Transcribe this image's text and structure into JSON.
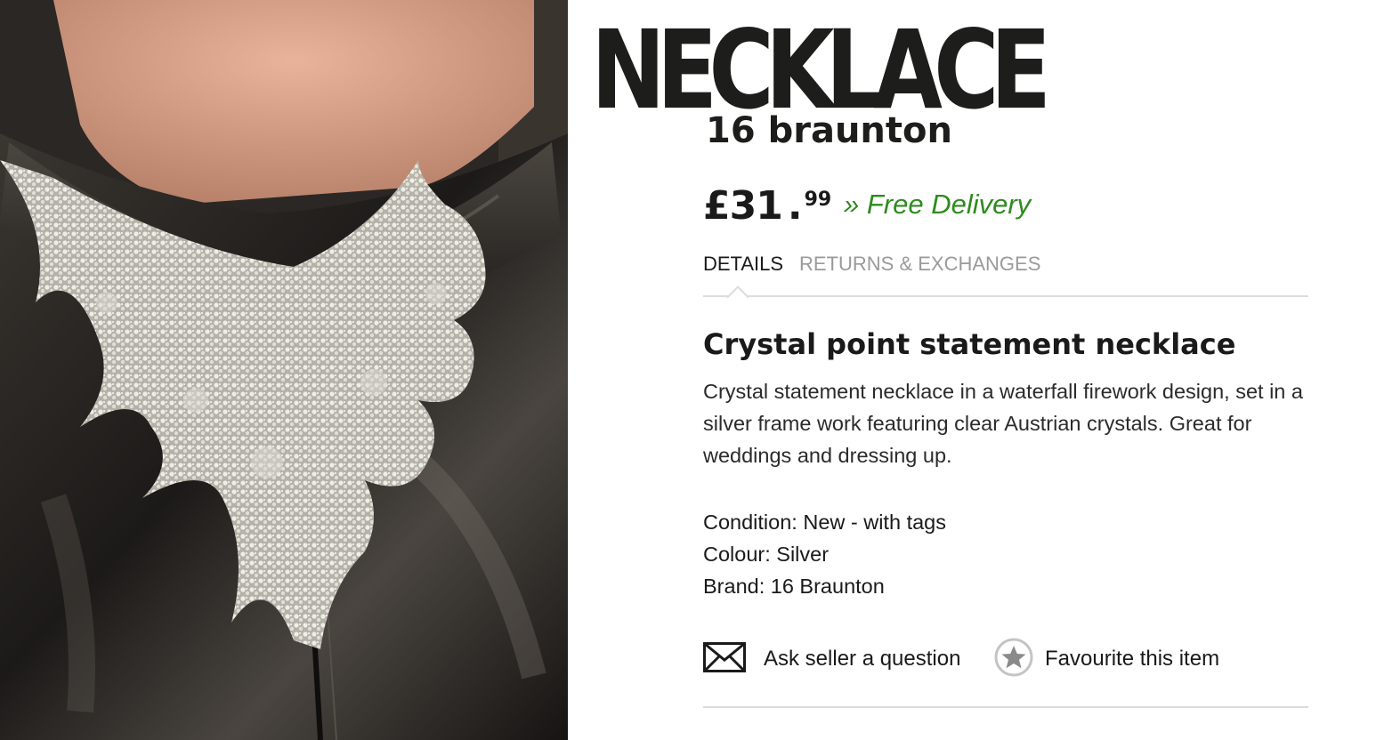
{
  "product": {
    "category_title": "NECKLACE",
    "seller_name": "16 braunton",
    "price": {
      "main": "£31",
      "dot": ".",
      "pence": "99"
    },
    "delivery_text": "» Free Delivery",
    "name": "Crystal point statement necklace",
    "description": "Crystal statement necklace in a waterfall firework design, set in a silver frame work featuring clear Austrian crystals. Great for weddings and dressing up.",
    "specs": [
      "Condition: New - with tags",
      "Colour: Silver",
      "Brand: 16 Braunton"
    ]
  },
  "tabs": {
    "details": "DETAILS",
    "returns": "RETURNS & EXCHANGES",
    "active": "details"
  },
  "actions": {
    "ask_label": "Ask seller a question",
    "ask_icon": "envelope-icon",
    "favourite_label": "Favourite this item",
    "favourite_icon": "star-icon"
  },
  "photo": {
    "subject": "necklace-photo"
  },
  "colors": {
    "delivery_green": "#2e8b1e",
    "inactive_tab": "#9a9a9a",
    "rule": "#dcdcdc",
    "title_black": "#1d1d1b"
  }
}
